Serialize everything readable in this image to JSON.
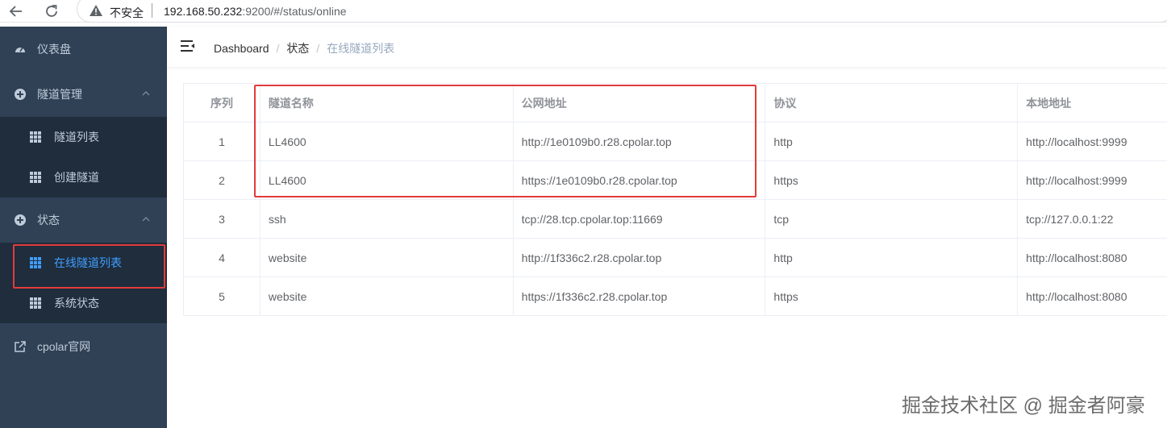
{
  "browser": {
    "insecure_label": "不安全",
    "url_host": "192.168.50.232",
    "url_rest": ":9200/#/status/online"
  },
  "sidebar": {
    "items": [
      {
        "label": "仪表盘",
        "icon": "dashboard-icon"
      },
      {
        "label": "隧道管理",
        "icon": "tunnel-manage-icon",
        "expanded": true,
        "children": [
          {
            "label": "隧道列表",
            "icon": "table-icon"
          },
          {
            "label": "创建隧道",
            "icon": "table-icon"
          }
        ]
      },
      {
        "label": "状态",
        "icon": "status-icon",
        "expanded": true,
        "children": [
          {
            "label": "在线隧道列表",
            "icon": "table-icon",
            "active": true
          },
          {
            "label": "系统状态",
            "icon": "table-icon"
          }
        ]
      },
      {
        "label": "cpolar官网",
        "icon": "external-link-icon"
      }
    ]
  },
  "breadcrumb": [
    "Dashboard",
    "状态",
    "在线隧道列表"
  ],
  "table": {
    "headers": [
      "序列",
      "隧道名称",
      "公网地址",
      "协议",
      "本地地址"
    ],
    "rows": [
      [
        "1",
        "LL4600",
        "http://1e0109b0.r28.cpolar.top",
        "http",
        "http://localhost:9999"
      ],
      [
        "2",
        "LL4600",
        "https://1e0109b0.r28.cpolar.top",
        "https",
        "http://localhost:9999"
      ],
      [
        "3",
        "ssh",
        "tcp://28.tcp.cpolar.top:11669",
        "tcp",
        "tcp://127.0.0.1:22"
      ],
      [
        "4",
        "website",
        "http://1f336c2.r28.cpolar.top",
        "http",
        "http://localhost:8080"
      ],
      [
        "5",
        "website",
        "https://1f336c2.r28.cpolar.top",
        "https",
        "http://localhost:8080"
      ]
    ]
  },
  "watermark": "掘金技术社区 @ 掘金者阿豪",
  "colors": {
    "sidebar_bg": "#304156",
    "submenu_bg": "#1f2d3d",
    "active": "#409eff",
    "highlight": "#e33b3b"
  }
}
